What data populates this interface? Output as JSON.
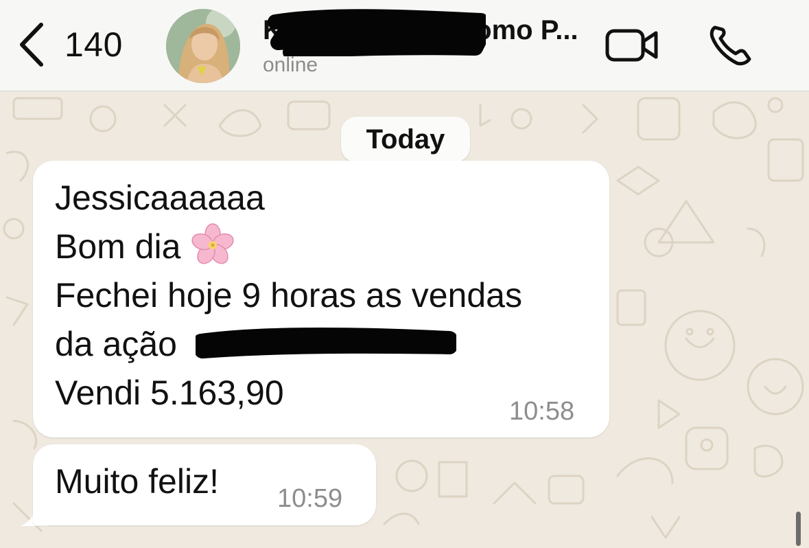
{
  "header": {
    "back_count": "140",
    "contact_name": "Ka",
    "contact_name_tail": "omo P...",
    "status": "online"
  },
  "chat": {
    "date_label": "Today",
    "messages": [
      {
        "lines": [
          "Jessicaaaaaa",
          "Bom dia",
          "Fechei hoje 9 horas as vendas",
          "da ação",
          "Vendi 5.163,90"
        ],
        "time": "10:58"
      },
      {
        "lines": [
          "Muito feliz!"
        ],
        "time": "10:59"
      }
    ]
  },
  "colors": {
    "header_bg": "#f7f7f5",
    "chat_bg": "#efe9df",
    "bubble_bg": "#ffffff",
    "timestamp": "#8d8d8d",
    "status": "#8c8c8c"
  },
  "icons": [
    "chevron-left-icon",
    "video-camera-icon",
    "phone-icon",
    "cherry-blossom-emoji"
  ]
}
